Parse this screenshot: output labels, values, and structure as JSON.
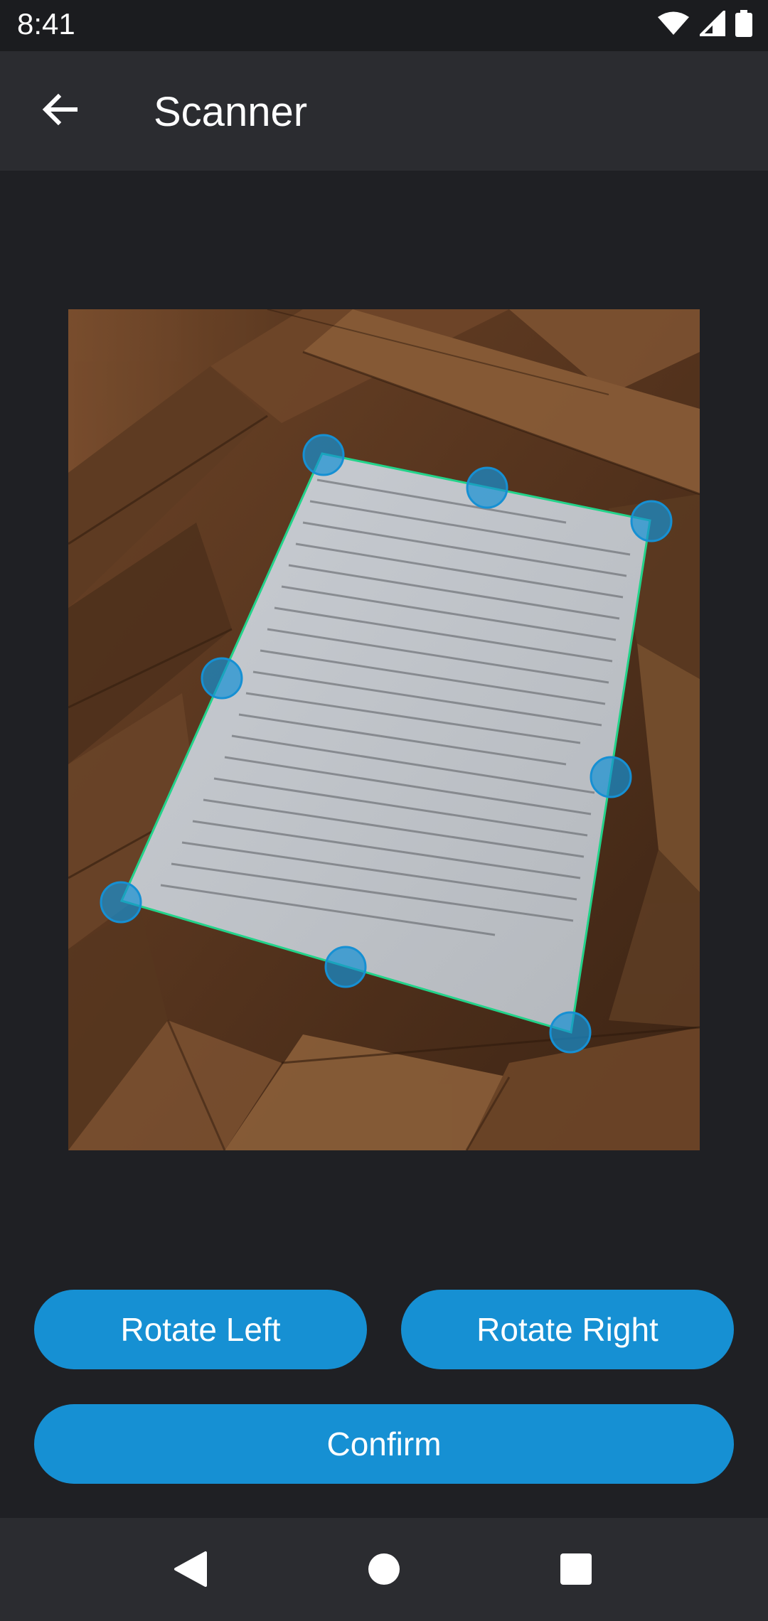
{
  "status_bar": {
    "time": "8:41",
    "icons": [
      "wifi-icon",
      "cell-signal-icon",
      "battery-icon"
    ]
  },
  "app_bar": {
    "back_icon": "arrow-left-icon",
    "title": "Scanner"
  },
  "scan_preview": {
    "crop_handle_count": 8,
    "accent_color": "#1690d3",
    "crop_border_color": "#22d38a"
  },
  "actions": {
    "rotate_left_label": "Rotate Left",
    "rotate_right_label": "Rotate Right",
    "confirm_label": "Confirm"
  },
  "nav_bar": {
    "icons": [
      "back-triangle-icon",
      "home-circle-icon",
      "recents-square-icon"
    ]
  },
  "colors": {
    "background": "#1f2024",
    "app_bar": "#2b2c30",
    "button": "#1690d3"
  }
}
